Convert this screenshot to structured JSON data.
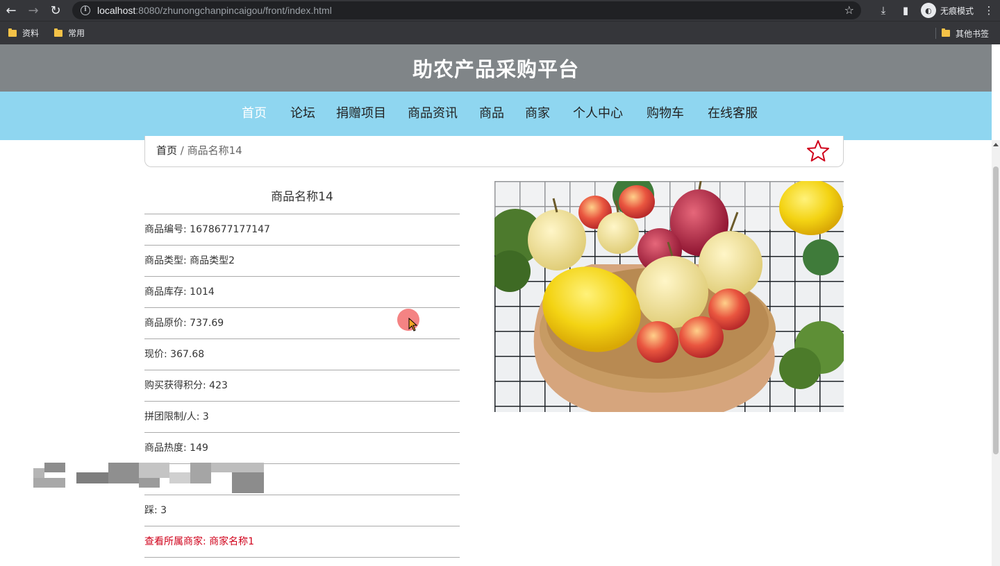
{
  "browser": {
    "url_host": "localhost",
    "url_rest": ":8080/zhunongchanpincaigou/front/index.html",
    "incognito_label": "无痕模式",
    "bookmarks": [
      "资料",
      "常用"
    ],
    "other_bookmarks": "其他书签"
  },
  "site": {
    "title": "助农产品采购平台",
    "nav": [
      "首页",
      "论坛",
      "捐赠项目",
      "商品资讯",
      "商品",
      "商家",
      "个人中心",
      "购物车",
      "在线客服"
    ],
    "active_nav": "首页"
  },
  "breadcrumb": {
    "home": "首页",
    "separator": "/",
    "current": "商品名称14"
  },
  "product": {
    "name": "商品名称14",
    "fields": [
      {
        "label": "商品编号",
        "value": "1678677177147"
      },
      {
        "label": "商品类型",
        "value": "商品类型2"
      },
      {
        "label": "商品库存",
        "value": "1014"
      },
      {
        "label": "商品原价",
        "value": "737.69"
      },
      {
        "label": "现价",
        "value": "367.68"
      },
      {
        "label": "购买获得积分",
        "value": "423"
      },
      {
        "label": "拼团限制/人",
        "value": "3"
      },
      {
        "label": "商品热度",
        "value": "149"
      },
      {
        "label": "",
        "value": ""
      },
      {
        "label": "踩",
        "value": "3"
      }
    ],
    "merchant_link": {
      "label": "查看所属商家",
      "value": "商家名称1"
    }
  },
  "colors": {
    "header_bg": "#808588",
    "nav_bg": "#8fd6f0",
    "link_red": "#d0021b",
    "star_red": "#d0021b"
  }
}
